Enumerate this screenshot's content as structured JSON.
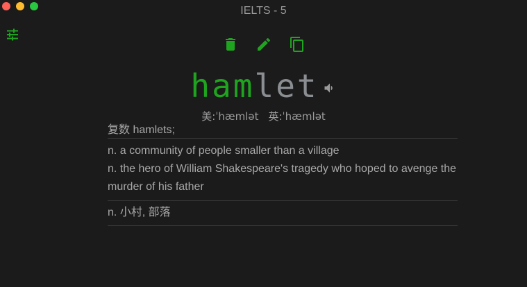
{
  "window": {
    "title": "IELTS - 5"
  },
  "toolbar": {
    "icons": [
      "settings-sliders-icon",
      "trash-icon",
      "pencil-icon",
      "copy-icon",
      "speaker-icon"
    ],
    "accent_color": "#1fa41f"
  },
  "word": {
    "known_part": "ham",
    "rest_part": "let"
  },
  "phonetics": {
    "us": "美:ˈhæmlət",
    "uk": "英:ˈhæmlət"
  },
  "inflection": "复数 hamlets;",
  "english_definitions": [
    "n. a community of people smaller than a village",
    "n. the hero of William Shakespeare's tragedy who hoped to avenge the murder of his father"
  ],
  "chinese_definitions": [
    "n. 小村, 部落"
  ]
}
